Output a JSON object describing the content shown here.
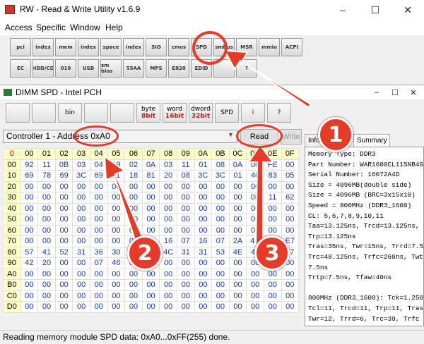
{
  "app": {
    "title": "RW - Read & Write Utility v1.6.9"
  },
  "window_controls": {
    "minimize": "–",
    "maximize": "☐",
    "close": "✕"
  },
  "menu": [
    "Access",
    "Specific",
    "Window",
    "Help"
  ],
  "toolbar": {
    "row1": [
      "pci",
      "index",
      "mem",
      "index",
      "space",
      "index",
      "SIO",
      "cmos",
      "SPD",
      "smbus",
      "MSR",
      "mmio",
      "ACPI"
    ],
    "row2": [
      "EC",
      "HDD/CD",
      "010",
      "USB",
      "sm bios",
      "55AA",
      "MPS",
      "E820",
      "EDID",
      "",
      "?"
    ]
  },
  "inner_window": {
    "title": "DIMM SPD - Intel PCH"
  },
  "inner_toolbar": [
    {
      "top": "",
      "bottom": "",
      "icon": "save"
    },
    {
      "top": "",
      "bottom": "",
      "icon": "copy"
    },
    {
      "top": "bin",
      "bottom": "",
      "icon": "bin"
    },
    {
      "top": "",
      "bottom": "",
      "icon": "binoculars"
    },
    {
      "top": "",
      "bottom": "",
      "icon": "grid"
    },
    {
      "top": "byte",
      "bottom": "8bit"
    },
    {
      "top": "word",
      "bottom": "16bit"
    },
    {
      "top": "dword",
      "bottom": "32bit"
    },
    {
      "top": "SPD",
      "bottom": "",
      "icon": "spd"
    },
    {
      "top": "i",
      "bottom": "",
      "icon": "info"
    },
    {
      "top": "?",
      "bottom": "",
      "icon": "help"
    }
  ],
  "controller": {
    "value": "Controller 1 - Address 0xA0"
  },
  "buttons": {
    "read": "Read",
    "write": "Write"
  },
  "tabs": [
    "Info",
    "Summary"
  ],
  "hex": {
    "corner": "0",
    "columns": [
      "00",
      "01",
      "02",
      "03",
      "04",
      "05",
      "06",
      "07",
      "08",
      "09",
      "0A",
      "0B",
      "0C",
      "0D",
      "0E",
      "0F"
    ],
    "rows": [
      {
        "addr": "00",
        "cells": [
          "92",
          "11",
          "0B",
          "03",
          "04",
          "19",
          "02",
          "0A",
          "03",
          "11",
          "01",
          "08",
          "0A",
          "00",
          "FE",
          "00"
        ]
      },
      {
        "addr": "10",
        "cells": [
          "69",
          "78",
          "69",
          "3C",
          "69",
          "11",
          "18",
          "81",
          "20",
          "08",
          "3C",
          "3C",
          "01",
          "40",
          "83",
          "05"
        ]
      },
      {
        "addr": "20",
        "cells": [
          "00",
          "00",
          "00",
          "00",
          "00",
          "00",
          "00",
          "00",
          "00",
          "00",
          "00",
          "00",
          "00",
          "00",
          "00",
          "00"
        ]
      },
      {
        "addr": "30",
        "cells": [
          "00",
          "00",
          "00",
          "00",
          "00",
          "00",
          "00",
          "00",
          "00",
          "00",
          "00",
          "00",
          "00",
          "0F",
          "11",
          "62"
        ]
      },
      {
        "addr": "40",
        "cells": [
          "00",
          "00",
          "00",
          "00",
          "00",
          "00",
          "00",
          "00",
          "00",
          "00",
          "00",
          "00",
          "00",
          "00",
          "00",
          "00"
        ]
      },
      {
        "addr": "50",
        "cells": [
          "00",
          "00",
          "00",
          "00",
          "00",
          "00",
          "00",
          "00",
          "00",
          "00",
          "00",
          "00",
          "00",
          "00",
          "00",
          "00"
        ]
      },
      {
        "addr": "60",
        "cells": [
          "00",
          "00",
          "00",
          "00",
          "00",
          "00",
          "00",
          "00",
          "00",
          "00",
          "00",
          "00",
          "00",
          "00",
          "00",
          "00"
        ]
      },
      {
        "addr": "70",
        "cells": [
          "00",
          "00",
          "00",
          "00",
          "00",
          "00",
          "00",
          "07",
          "16",
          "07",
          "16",
          "07",
          "2A",
          "4E",
          "F7",
          "E7"
        ]
      },
      {
        "addr": "80",
        "cells": [
          "57",
          "41",
          "52",
          "31",
          "36",
          "30",
          "30",
          "43",
          "4C",
          "31",
          "31",
          "53",
          "4E",
          "42",
          "34",
          "47"
        ]
      },
      {
        "addr": "90",
        "cells": [
          "42",
          "20",
          "00",
          "00",
          "07",
          "46",
          "00",
          "00",
          "00",
          "00",
          "00",
          "00",
          "00",
          "00",
          "00",
          "00"
        ]
      },
      {
        "addr": "A0",
        "cells": [
          "00",
          "00",
          "00",
          "00",
          "00",
          "00",
          "00",
          "00",
          "00",
          "00",
          "00",
          "00",
          "00",
          "00",
          "00",
          "00"
        ]
      },
      {
        "addr": "B0",
        "cells": [
          "00",
          "00",
          "00",
          "00",
          "00",
          "00",
          "00",
          "00",
          "00",
          "00",
          "00",
          "00",
          "00",
          "00",
          "00",
          "00"
        ]
      },
      {
        "addr": "C0",
        "cells": [
          "00",
          "00",
          "00",
          "00",
          "00",
          "00",
          "00",
          "00",
          "00",
          "00",
          "00",
          "00",
          "00",
          "00",
          "00",
          "00"
        ]
      },
      {
        "addr": "D0",
        "cells": [
          "00",
          "00",
          "00",
          "00",
          "00",
          "00",
          "00",
          "00",
          "00",
          "00",
          "00",
          "00",
          "00",
          "00",
          "00",
          "00"
        ]
      }
    ]
  },
  "info_lines": [
    "Memory Type: DDR3",
    "Part Number: WAR1600CL11SNB4G",
    "Serial Number: 16072A4D",
    "Size = 4096MB(double side)",
    "Size = 4096MB (BRC=3x15x10)",
    "Speed = 800MHz (DDR3_1600)",
    "CL: 5,6,7,8,9,10,11",
    "Taa=13.125ns, Trcd=13.125ns,",
    "Trp=13.125ns",
    "Tras=35ns, Twr=15ns, Trrd=7.5n",
    "Trc=48.125ns, Trfc=260ns, Twtr",
    "7.5ns",
    "Trtp=7.5ns, Tfaw=40ns",
    "",
    "800MHz (DDR3_1600): Tck=1.250",
    " Tcl=11, Trcd=11, Trp=11, Tras",
    " Twr=12, Trrd=6, Trc=39, Trfc"
  ],
  "status": {
    "text": "Reading memory module SPD data: 0xA0...0xFF(255) done."
  },
  "annotations": [
    "1",
    "2",
    "3"
  ],
  "colors": {
    "annotation": "#e53c2a",
    "header": "#ffffc8",
    "hex_value": "#1a3aa5"
  }
}
